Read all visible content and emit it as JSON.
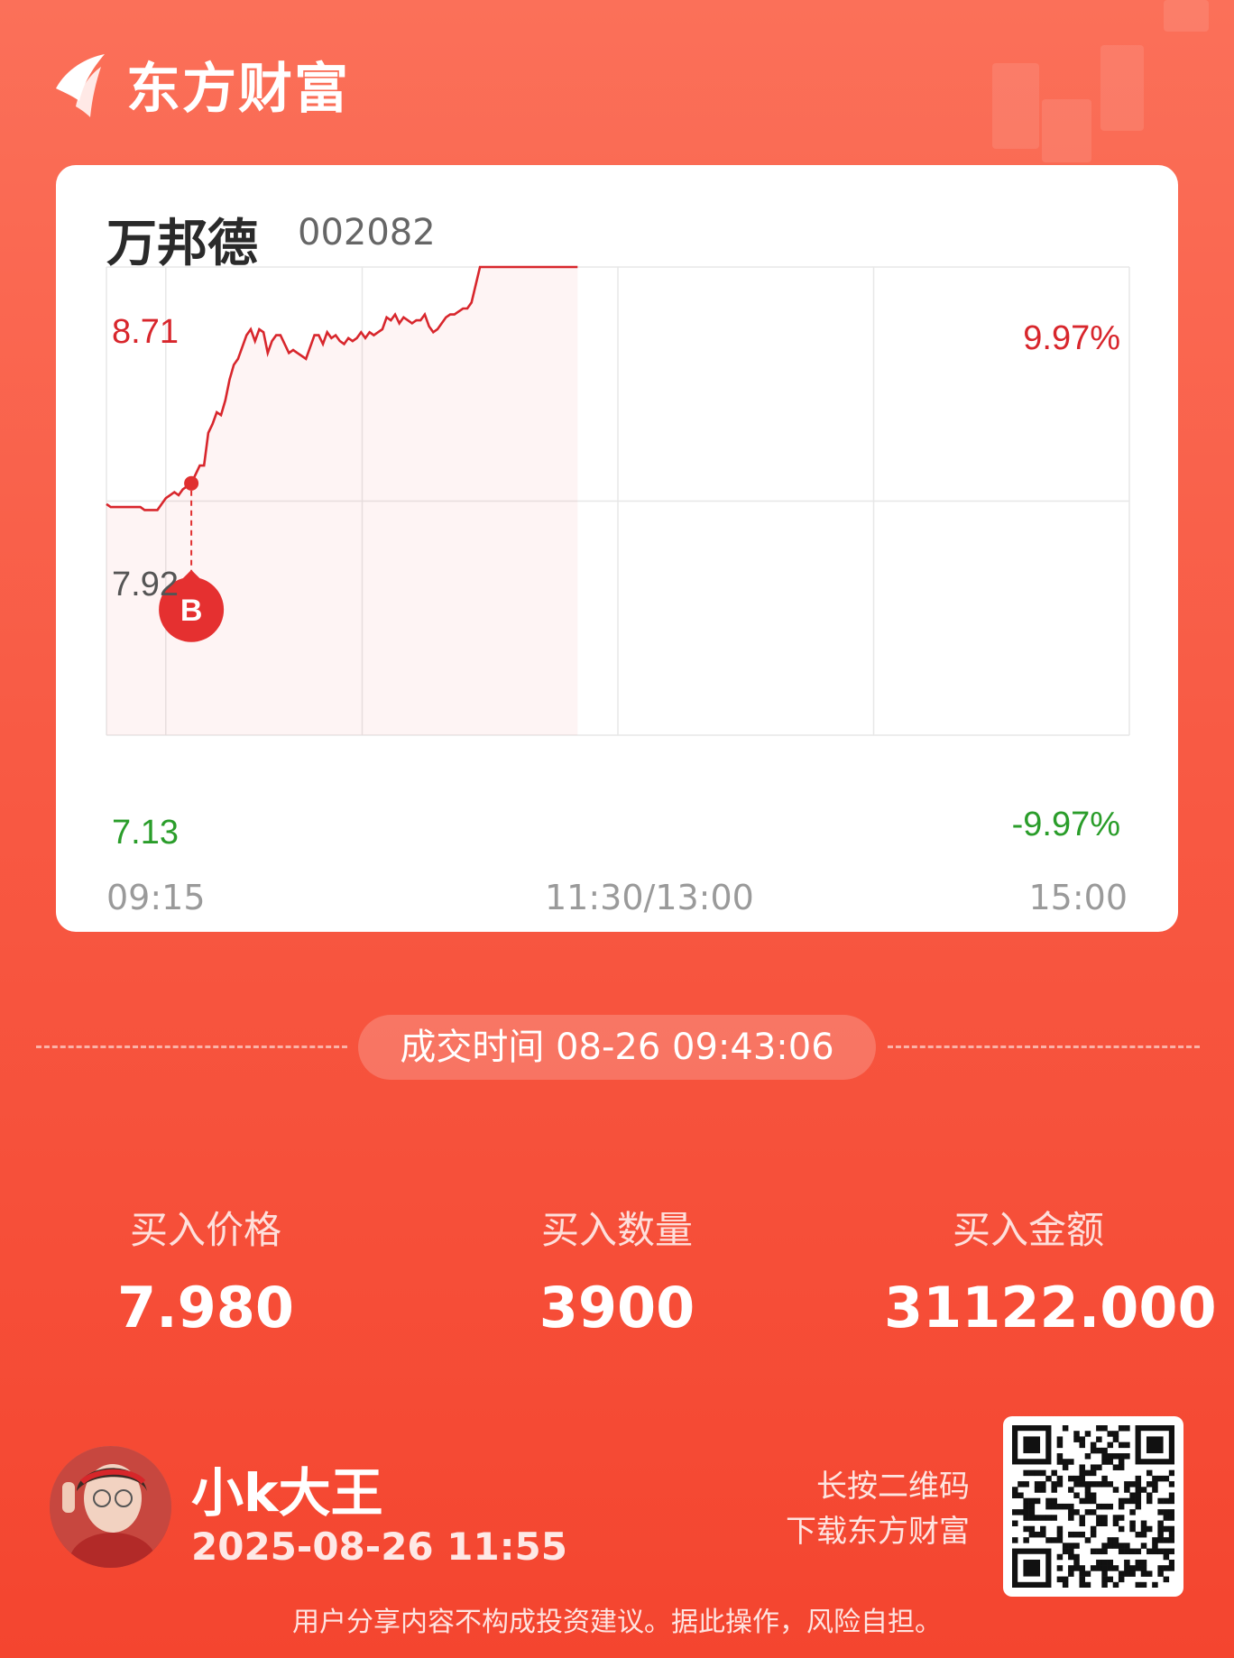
{
  "brand": {
    "name": "东方财富"
  },
  "stock": {
    "name": "万邦德",
    "code": "002082"
  },
  "chart_data": {
    "type": "line",
    "price_labels": {
      "high": "8.71",
      "mid": "7.92",
      "low": "7.13"
    },
    "pct_labels": {
      "high": "9.97%",
      "low": "-9.97%"
    },
    "time_labels": [
      "09:15",
      "11:30/13:00",
      "15:00"
    ],
    "ylim": [
      7.13,
      8.71
    ],
    "buy_marker": {
      "label": "B",
      "time_index": 20,
      "price": 7.98
    },
    "series": [
      {
        "values": [
          7.91,
          7.9,
          7.9,
          7.9,
          7.9,
          7.9,
          7.9,
          7.9,
          7.9,
          7.89,
          7.89,
          7.89,
          7.89,
          7.91,
          7.93,
          7.94,
          7.95,
          7.94,
          7.96,
          7.97,
          7.98,
          8.01,
          8.04,
          8.04,
          8.15,
          8.18,
          8.22,
          8.21,
          8.26,
          8.33,
          8.38,
          8.4,
          8.44,
          8.48,
          8.5,
          8.46,
          8.5,
          8.49,
          8.42,
          8.46,
          8.48,
          8.48,
          8.45,
          8.42,
          8.43,
          8.42,
          8.41,
          8.4,
          8.44,
          8.48,
          8.48,
          8.45,
          8.49,
          8.47,
          8.48,
          8.46,
          8.45,
          8.47,
          8.46,
          8.47,
          8.49,
          8.47,
          8.49,
          8.48,
          8.49,
          8.5,
          8.54,
          8.53,
          8.55,
          8.52,
          8.54,
          8.53,
          8.52,
          8.53,
          8.53,
          8.55,
          8.51,
          8.49,
          8.5,
          8.52,
          8.54,
          8.55,
          8.55,
          8.56,
          8.57,
          8.57,
          8.59,
          8.65,
          8.71,
          8.71,
          8.71,
          8.71,
          8.71,
          8.71,
          8.71,
          8.71,
          8.71,
          8.71,
          8.71,
          8.71,
          8.71,
          8.71,
          8.71,
          8.71,
          8.71,
          8.71,
          8.71,
          8.71,
          8.71,
          8.71,
          8.71,
          8.71
        ]
      }
    ],
    "total_points": 242
  },
  "trade": {
    "time_label": "成交时间 08-26 09:43:06",
    "price_label": "买入价格",
    "price_value": "7.980",
    "qty_label": "买入数量",
    "qty_value": "3900",
    "amount_label": "买入金额",
    "amount_value": "31122.000"
  },
  "user": {
    "name": "小k大王",
    "time": "2025-08-26 11:55"
  },
  "qr": {
    "line1": "长按二维码",
    "line2": "下载东方财富"
  },
  "disclaimer": "用户分享内容不构成投资建议。据此操作，风险自担。",
  "colors": {
    "up": "#e02f2f",
    "down": "#2a9d2a",
    "accent": "#f85a44"
  }
}
